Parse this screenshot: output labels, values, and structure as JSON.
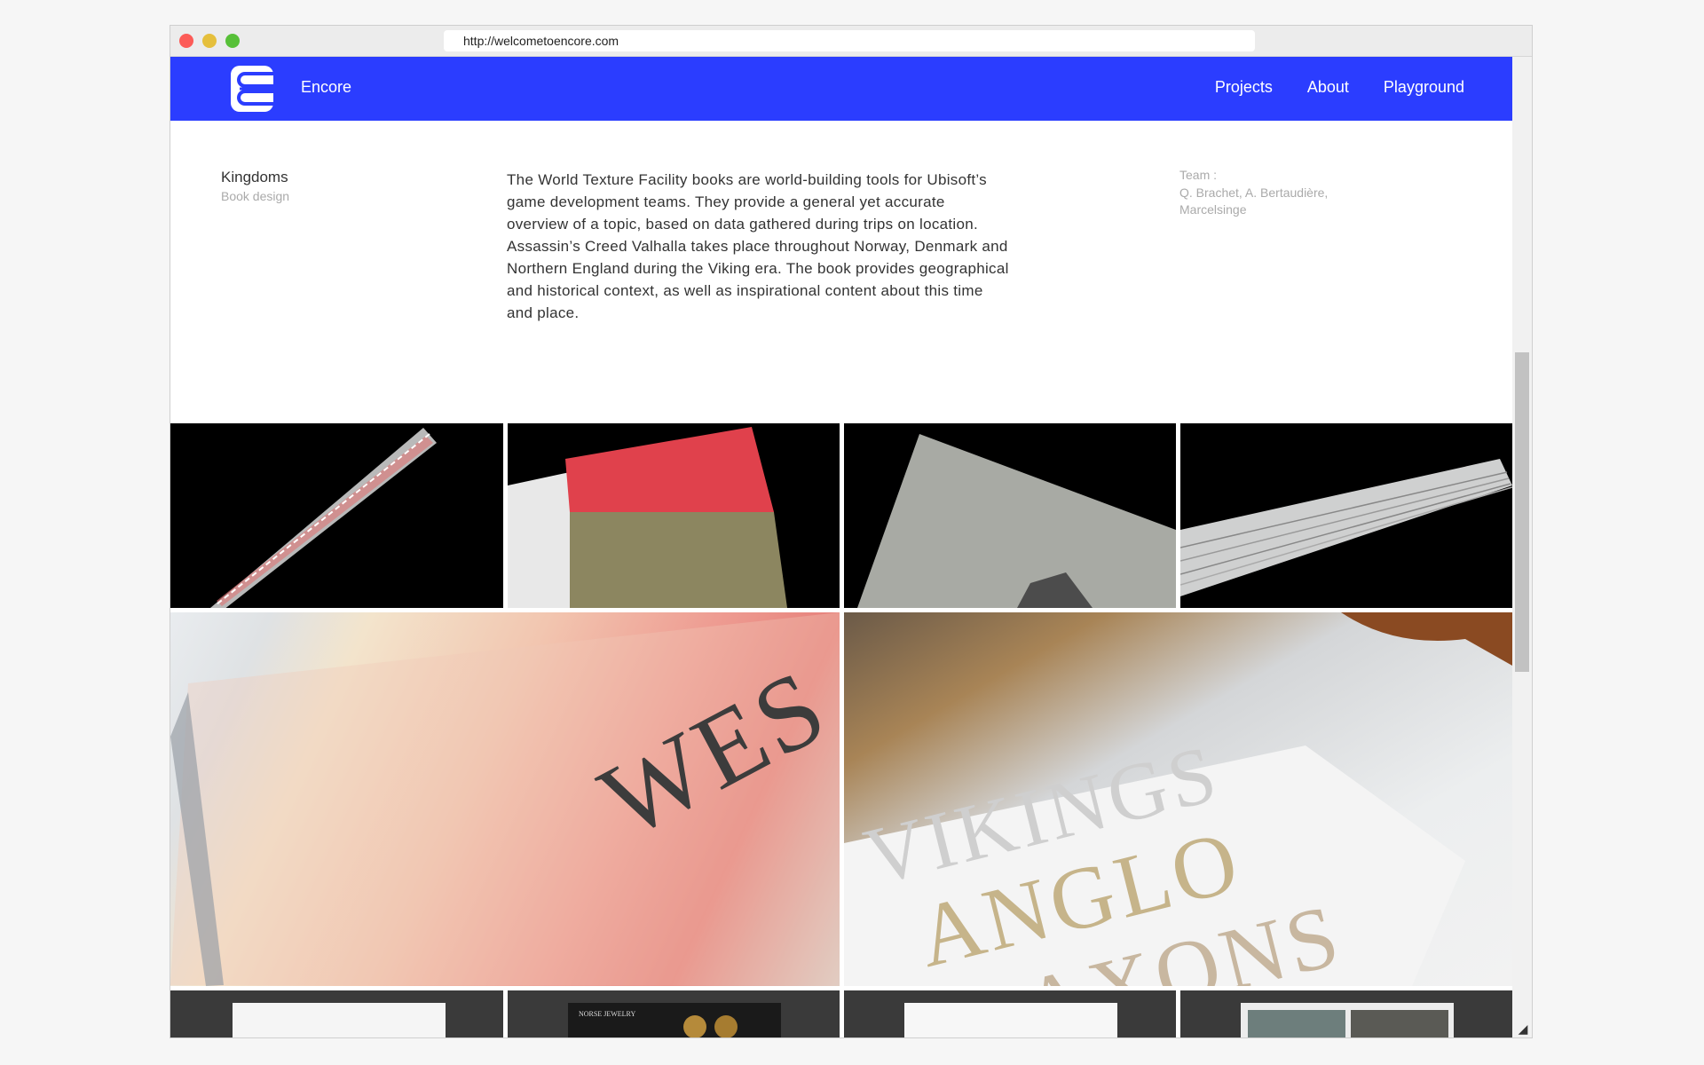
{
  "browser": {
    "url": "http://welcometoencore.com"
  },
  "nav": {
    "brand": "Encore",
    "links": [
      "Projects",
      "About",
      "Playground"
    ]
  },
  "project": {
    "title": "Kingdoms",
    "category": "Book design",
    "description": "The World Texture Facility books are world-building tools for Ubisoft’s game development teams. They provide a general yet accurate overview of a topic, based on data gathered during trips on location. Assassin’s Creed Valhalla takes place throughout Norway, Denmark and Northern England during the Viking era. The book provides geographical and historical context, as well as inspirational content about this time and place.",
    "team_label": "Team :",
    "team_names": "Q. Brachet, A. Bertaudière, Marcelsinge"
  },
  "gallery": {
    "photo5_text": "WES",
    "photo6_line1": "VIKINGS",
    "photo6_line2": "ANGLO",
    "photo6_line3": "SAXONS",
    "thumb2_heading": "NORSE JEWELRY"
  },
  "colors": {
    "nav_bg": "#2b3dff",
    "text": "#333333",
    "muted": "#aaaaaa"
  }
}
